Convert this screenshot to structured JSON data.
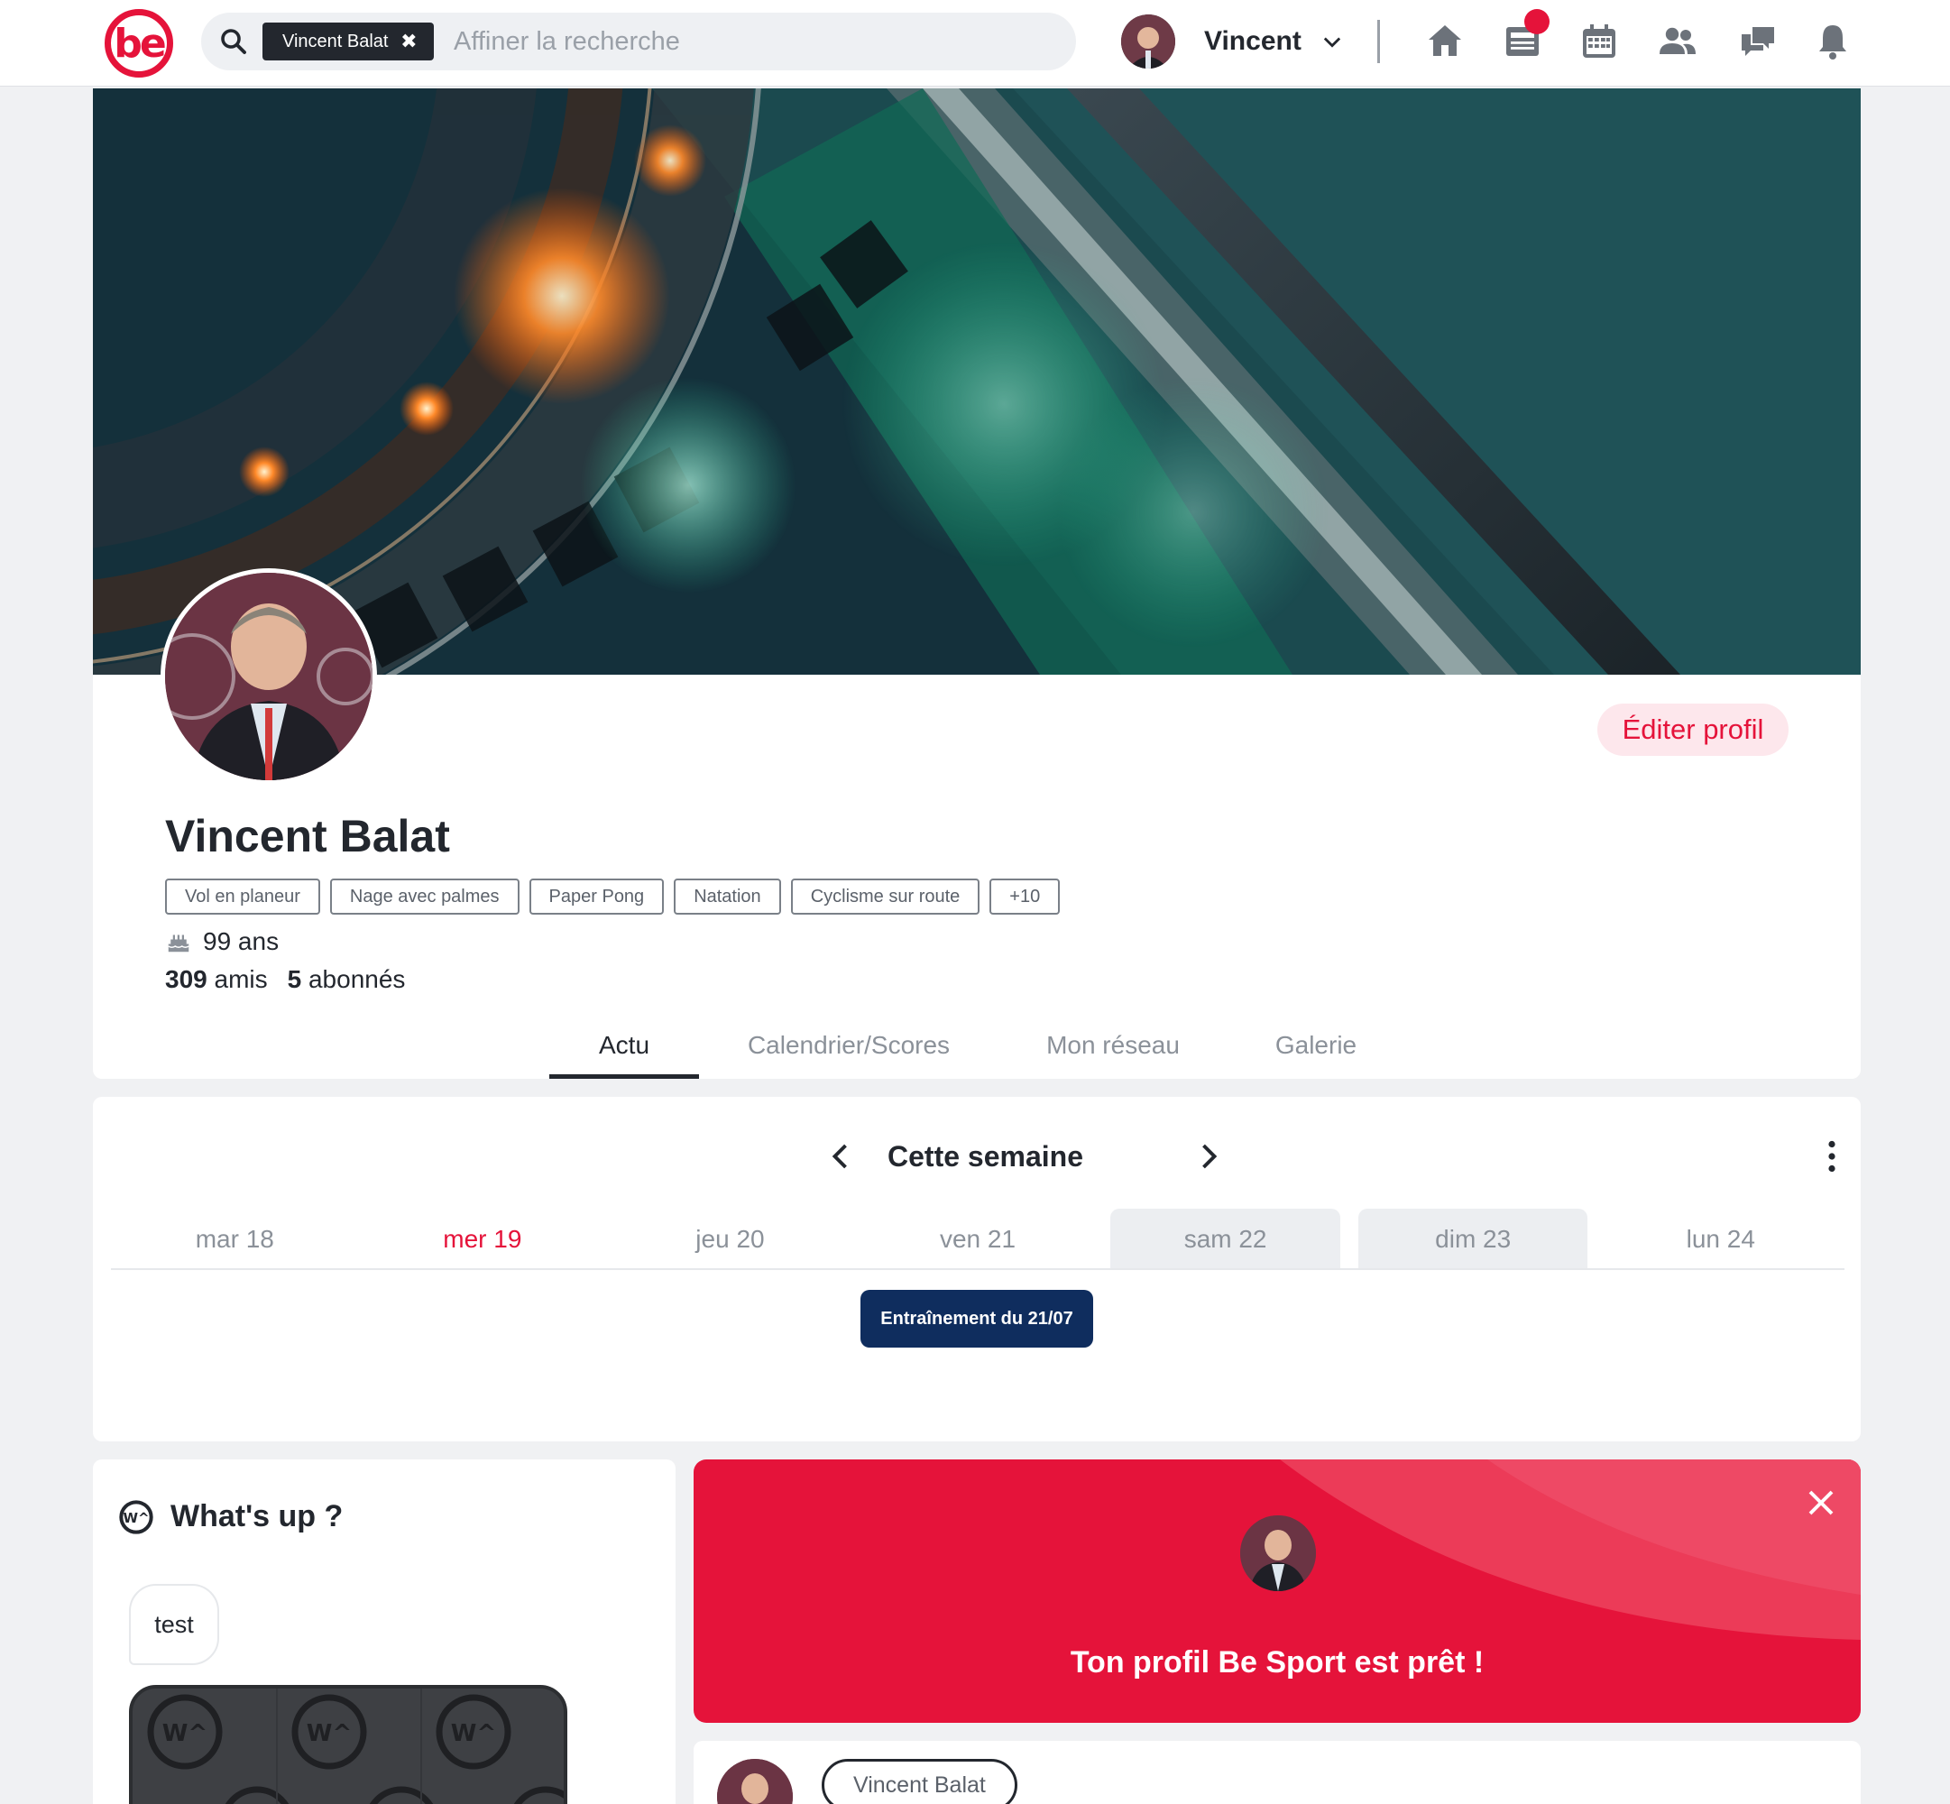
{
  "colors": {
    "brand": "#e5133a",
    "event": "#0f2d5e",
    "text": "#23272e",
    "muted": "#8b9199"
  },
  "topbar": {
    "logo_text": "be",
    "search_chip": "Vincent Balat",
    "search_placeholder": "Affiner la recherche",
    "user_name": "Vincent",
    "nav_icons": [
      "home-icon",
      "news-icon",
      "calendar-icon",
      "friends-icon",
      "chat-icon",
      "bell-icon"
    ]
  },
  "profile": {
    "name": "Vincent Balat",
    "edit_label": "Éditer profil",
    "tags": [
      "Vol en planeur",
      "Nage avec palmes",
      "Paper Pong",
      "Natation",
      "Cyclisme sur route",
      "+10"
    ],
    "age": "99 ans",
    "friends_count": "309",
    "friends_label": "amis",
    "followers_count": "5",
    "followers_label": "abonnés",
    "tabs": [
      "Actu",
      "Calendrier/Scores",
      "Mon réseau",
      "Galerie"
    ],
    "active_tab": "Actu"
  },
  "calendar": {
    "title": "Cette semaine",
    "days": [
      "mar 18",
      "mer 19",
      "jeu 20",
      "ven 21",
      "sam 22",
      "dim 23",
      "lun 24"
    ],
    "today": "mer 19",
    "event_label": "Entraînement du 21/07"
  },
  "whatsup": {
    "title": "What's up ?",
    "bubble_text": "test"
  },
  "promo": {
    "text": "Ton profil Be Sport est prêt !"
  },
  "post": {
    "author": "Vincent Balat"
  }
}
